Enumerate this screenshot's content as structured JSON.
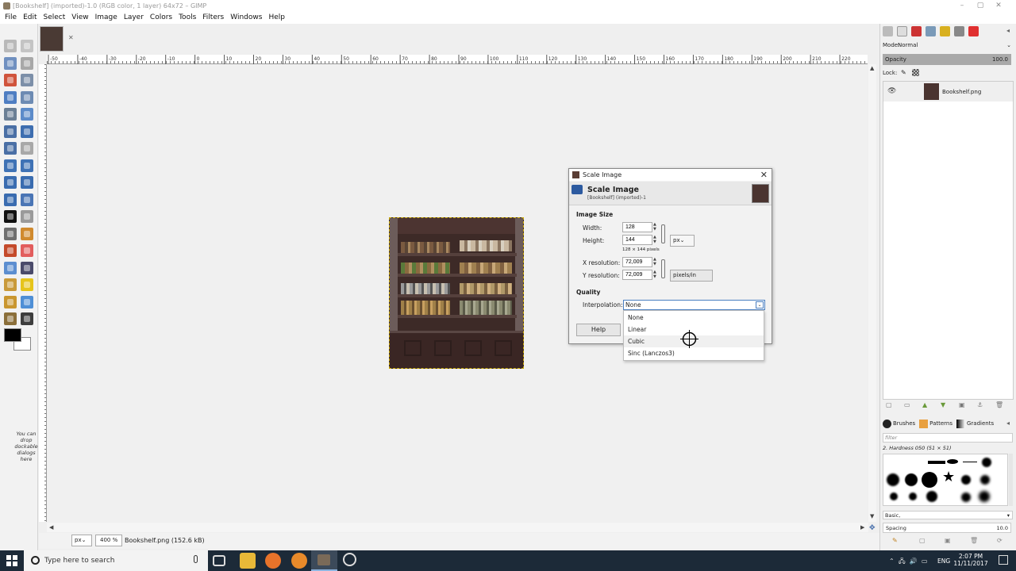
{
  "window": {
    "title": "[Bookshelf] (imported)-1.0 (RGB color, 1 layer) 64x72 – GIMP",
    "controls": [
      "–",
      "▢",
      "✕"
    ]
  },
  "menu": [
    "File",
    "Edit",
    "Select",
    "View",
    "Image",
    "Layer",
    "Colors",
    "Tools",
    "Filters",
    "Windows",
    "Help"
  ],
  "toolbox": {
    "drop_hint": "You can drop dockable dialogs here"
  },
  "ruler_labels": [
    "-50",
    "-40",
    "-30",
    "-20",
    "-10",
    "0",
    "10",
    "20",
    "30",
    "40",
    "50",
    "60",
    "70",
    "80",
    "90",
    "100",
    "110",
    "120",
    "130",
    "140",
    "150",
    "160",
    "170",
    "180",
    "190",
    "200",
    "210",
    "220"
  ],
  "statusbar": {
    "unit": "px",
    "zoom": "400 %",
    "text": "Bookshelf.png (152.6 kB)"
  },
  "layers_panel": {
    "mode_label": "Mode:",
    "mode_value": "Normal",
    "opacity_label": "Opacity",
    "opacity_value": "100.0",
    "lock_label": "Lock:",
    "layer_name": "Bookshelf.png"
  },
  "brushes_panel": {
    "tabs": [
      "Brushes",
      "Patterns",
      "Gradients"
    ],
    "filter_placeholder": "filter",
    "brush_name": "2. Hardness 050 (51 × 51)",
    "preset": "Basic,",
    "spacing_label": "Spacing",
    "spacing_value": "10.0"
  },
  "dialog": {
    "window_title": "Scale Image",
    "header_title": "Scale Image",
    "header_subtitle": "[Bookshelf] (imported)-1",
    "image_size_label": "Image Size",
    "width_label": "Width:",
    "width_value": "128",
    "height_label": "Height:",
    "height_value": "144",
    "size_unit": "px",
    "size_note": "128 × 144 pixels",
    "xres_label": "X resolution:",
    "xres_value": "72,009",
    "yres_label": "Y resolution:",
    "yres_value": "72,009",
    "res_unit": "pixels/in",
    "quality_label": "Quality",
    "interp_label": "Interpolation:",
    "interp_value": "None",
    "help_button": "Help"
  },
  "interp_options": [
    "None",
    "Linear",
    "Cubic",
    "Sinc (Lanczos3)"
  ],
  "taskbar": {
    "search_placeholder": "Type here to search",
    "lang": "ENG",
    "time": "2:07 PM",
    "date": "11/11/2017"
  }
}
